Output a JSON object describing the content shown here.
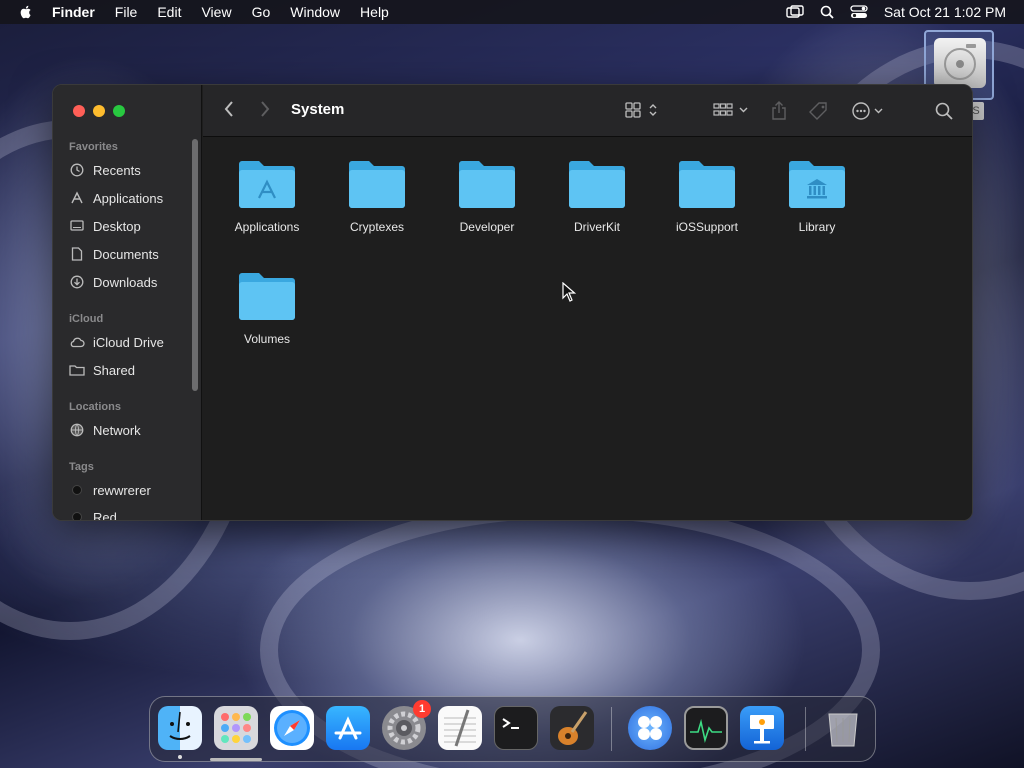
{
  "menubar": {
    "app_name": "Finder",
    "items": [
      "File",
      "Edit",
      "View",
      "Go",
      "Window",
      "Help"
    ],
    "clock": "Sat Oct 21  1:02 PM"
  },
  "desktop": {
    "drive_label": "S"
  },
  "window": {
    "title": "System",
    "sidebar": {
      "favorites_title": "Favorites",
      "favorites": [
        "Recents",
        "Applications",
        "Desktop",
        "Documents",
        "Downloads"
      ],
      "icloud_title": "iCloud",
      "icloud": [
        "iCloud Drive",
        "Shared"
      ],
      "locations_title": "Locations",
      "locations": [
        "Network"
      ],
      "tags_title": "Tags",
      "tags": [
        "rewwrerer",
        "Red"
      ]
    },
    "folders": [
      "Applications",
      "Cryptexes",
      "Developer",
      "DriverKit",
      "iOSSupport",
      "Library",
      "Volumes"
    ]
  },
  "dock": {
    "apps": [
      "Finder",
      "Launchpad",
      "Safari",
      "App Store",
      "System Settings",
      "TextEdit",
      "Terminal",
      "GarageBand",
      "Widgets",
      "Activity Monitor",
      "Keynote",
      "Trash"
    ],
    "settings_badge": "1"
  },
  "colors": {
    "folder": "#5ec4f3",
    "folder_dark": "#3aa8e0",
    "close": "#ff5f57",
    "minimize": "#febc2e",
    "zoom": "#28c840",
    "badge": "#ff3b30"
  }
}
